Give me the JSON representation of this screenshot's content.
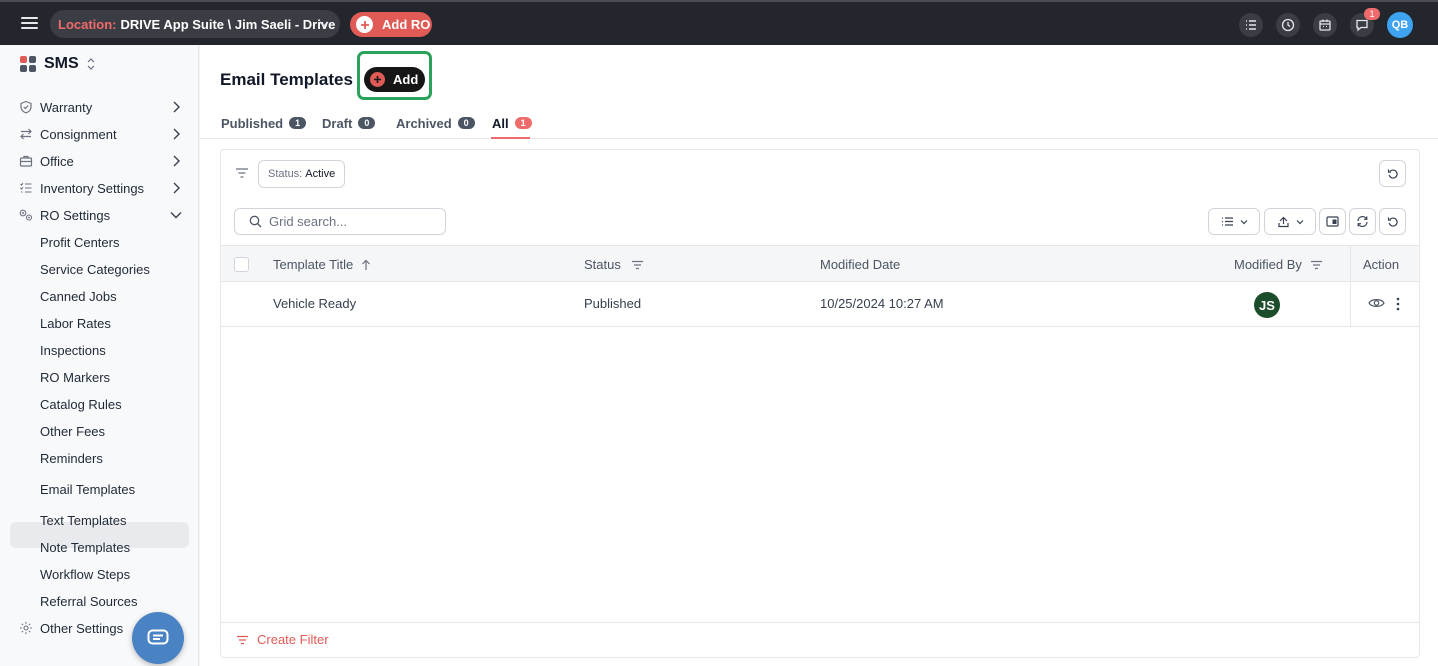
{
  "topbar": {
    "location_label": "Location:",
    "location_value": "DRIVE App Suite \\ Jim Saeli - Drive",
    "add_ro_label": "Add RO",
    "notification_count": "1",
    "user_initials": "QB"
  },
  "sidebar": {
    "app_title": "SMS",
    "nav": [
      {
        "label": "Warranty",
        "icon": "shield-icon"
      },
      {
        "label": "Consignment",
        "icon": "arrows-swap-icon"
      },
      {
        "label": "Office",
        "icon": "briefcase-icon"
      },
      {
        "label": "Inventory Settings",
        "icon": "checklist-icon"
      },
      {
        "label": "RO Settings",
        "icon": "gears-icon"
      }
    ],
    "ro_sub_items": [
      "Profit Centers",
      "Service Categories",
      "Canned Jobs",
      "Labor Rates",
      "Inspections",
      "RO Markers",
      "Catalog Rules",
      "Other Fees",
      "Reminders",
      "Email Templates",
      "Text Templates",
      "Note Templates",
      "Workflow Steps",
      "Referral Sources"
    ],
    "other_settings": "Other Settings"
  },
  "page": {
    "title": "Email Templates",
    "add_label": "Add",
    "tabs": [
      {
        "label": "Published",
        "count": "1"
      },
      {
        "label": "Draft",
        "count": "0"
      },
      {
        "label": "Archived",
        "count": "0"
      },
      {
        "label": "All",
        "count": "1",
        "active": true
      }
    ]
  },
  "grid": {
    "status_filter_key": "Status:",
    "status_filter_value": "Active",
    "search_placeholder": "Grid search...",
    "columns": [
      "Template Title",
      "Status",
      "Modified Date",
      "Modified By",
      "Action"
    ],
    "rows": [
      {
        "template_title": "Vehicle Ready",
        "status": "Published",
        "modified_date": "10/25/2024 10:27 AM",
        "modified_by_initials": "JS"
      }
    ],
    "create_filter_label": "Create Filter"
  },
  "colors": {
    "topbar_bg": "#23262d",
    "accent_red": "#e05b55",
    "highlight_green": "#2aa25a",
    "avatar_blue": "#3ea3f0",
    "avatar_green": "#1b4d2a"
  }
}
